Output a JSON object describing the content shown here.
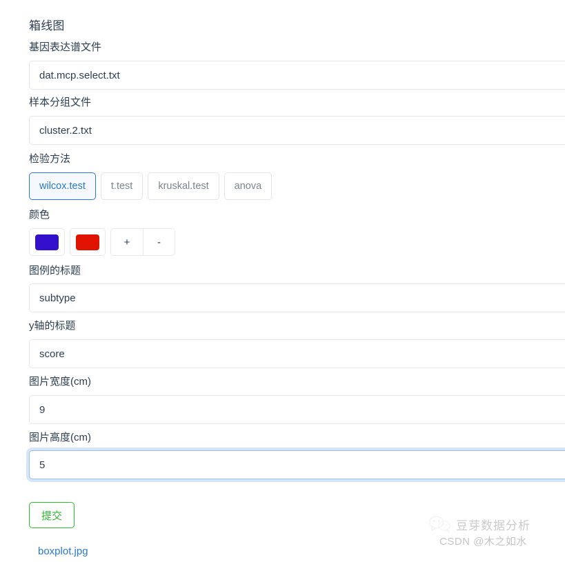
{
  "page": {
    "title": "箱线图"
  },
  "fields": {
    "expression_file": {
      "label": "基因表达谱文件",
      "value": "dat.mcp.select.txt",
      "placeholder": "dat.mcp.select.txt"
    },
    "group_file": {
      "label": "样本分组文件",
      "value": "cluster.2.txt",
      "placeholder": "cluster.2.txt"
    },
    "test_method": {
      "label": "检验方法",
      "selected": "wilcox.test",
      "options": [
        "wilcox.test",
        "t.test",
        "kruskal.test",
        "anova"
      ]
    },
    "color": {
      "label": "颜色",
      "swatches": [
        "#3311cc",
        "#e01200"
      ],
      "add_label": "+",
      "remove_label": "-"
    },
    "legend_title": {
      "label": "图例的标题",
      "value": "subtype",
      "placeholder": "subtype"
    },
    "y_axis_title": {
      "label": "y轴的标题",
      "value": "score",
      "placeholder": "score"
    },
    "image_width": {
      "label": "图片宽度(cm)",
      "value": "9",
      "placeholder": "9"
    },
    "image_height": {
      "label": "图片高度(cm)",
      "value": "5",
      "placeholder": "5",
      "focused": true
    }
  },
  "actions": {
    "submit_label": "提交"
  },
  "result": {
    "file_link": "boxplot.jpg"
  },
  "watermark": {
    "brand": "豆芽数据分析",
    "credit": "CSDN @木之如水"
  },
  "colors": {
    "accent_blue": "#2878d0",
    "submit_green": "#2db92d",
    "text_dark": "#2c3e50",
    "muted": "#7a8590",
    "border": "#e4e6e8"
  }
}
